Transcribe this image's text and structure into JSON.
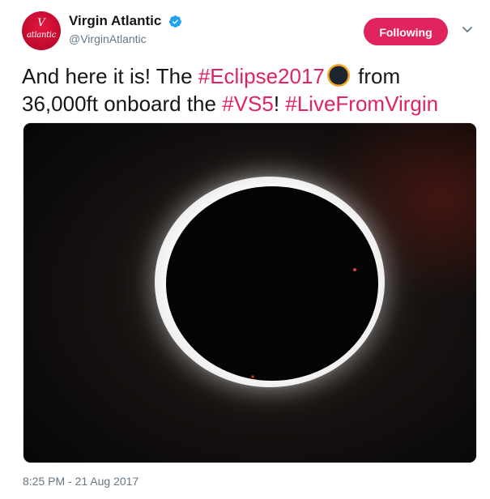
{
  "account": {
    "display_name": "Virgin Atlantic",
    "handle": "@VirginAtlantic",
    "verified": true,
    "avatar_icon": "virgin-atlantic-logo",
    "avatar_wordmark": "atlantic",
    "avatar_color": "#e2173d"
  },
  "follow_button": {
    "label": "Following",
    "color": "#e0245e"
  },
  "tweet": {
    "text_part1": "And here it is! The ",
    "hashtag1": "#Eclipse2017",
    "text_part2": " from 36,000ft onboard the ",
    "hashtag2": "#VS5",
    "text_part3": "! ",
    "hashtag3": "#LiveFromVirgin",
    "emoji": "solar-eclipse-emoji",
    "hashtag_color": "#e0245e"
  },
  "media": {
    "icon": "solar-eclipse-photo"
  },
  "timestamp": "8:25 PM - 21 Aug 2017"
}
